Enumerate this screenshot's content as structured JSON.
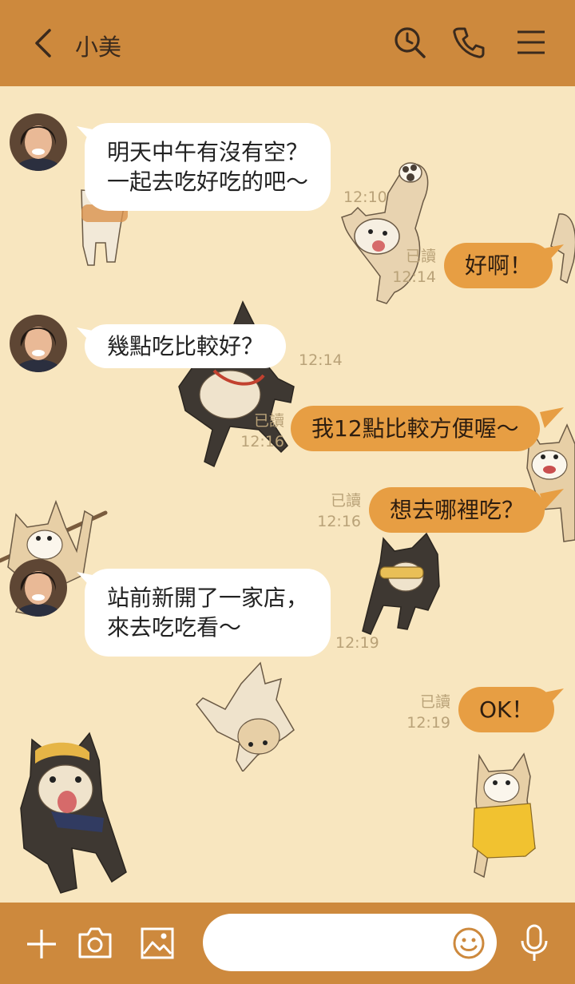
{
  "header": {
    "title": "小美",
    "icons": [
      "back-arrow-icon",
      "search-icon",
      "phone-icon",
      "menu-icon"
    ]
  },
  "colors": {
    "header_bg": "#cd893d",
    "chat_bg": "#f8e6bf",
    "incoming_bubble": "#ffffff",
    "outgoing_bubble": "#e79e43",
    "meta_text": "#b9a278"
  },
  "messages": [
    {
      "direction": "in",
      "text": "明天中午有沒有空？\n一起去吃好吃的吧～",
      "time": "12:10"
    },
    {
      "direction": "out",
      "text": "好啊！",
      "read": "已讀",
      "time": "12:14"
    },
    {
      "direction": "in",
      "text": "幾點吃比較好？",
      "time": "12:14"
    },
    {
      "direction": "out",
      "text": "我12點比較方便喔～",
      "read": "已讀",
      "time": "12:16"
    },
    {
      "direction": "out",
      "text": "想去哪裡吃？",
      "read": "已讀",
      "time": "12:16"
    },
    {
      "direction": "in",
      "text": "站前新開了一家店，\n來去吃吃看～",
      "time": "12:19"
    },
    {
      "direction": "out",
      "text": "OK！",
      "read": "已讀",
      "time": "12:19"
    }
  ],
  "footer": {
    "input_value": "",
    "icons": [
      "plus-icon",
      "camera-icon",
      "image-icon",
      "emoji-icon",
      "microphone-icon"
    ]
  }
}
